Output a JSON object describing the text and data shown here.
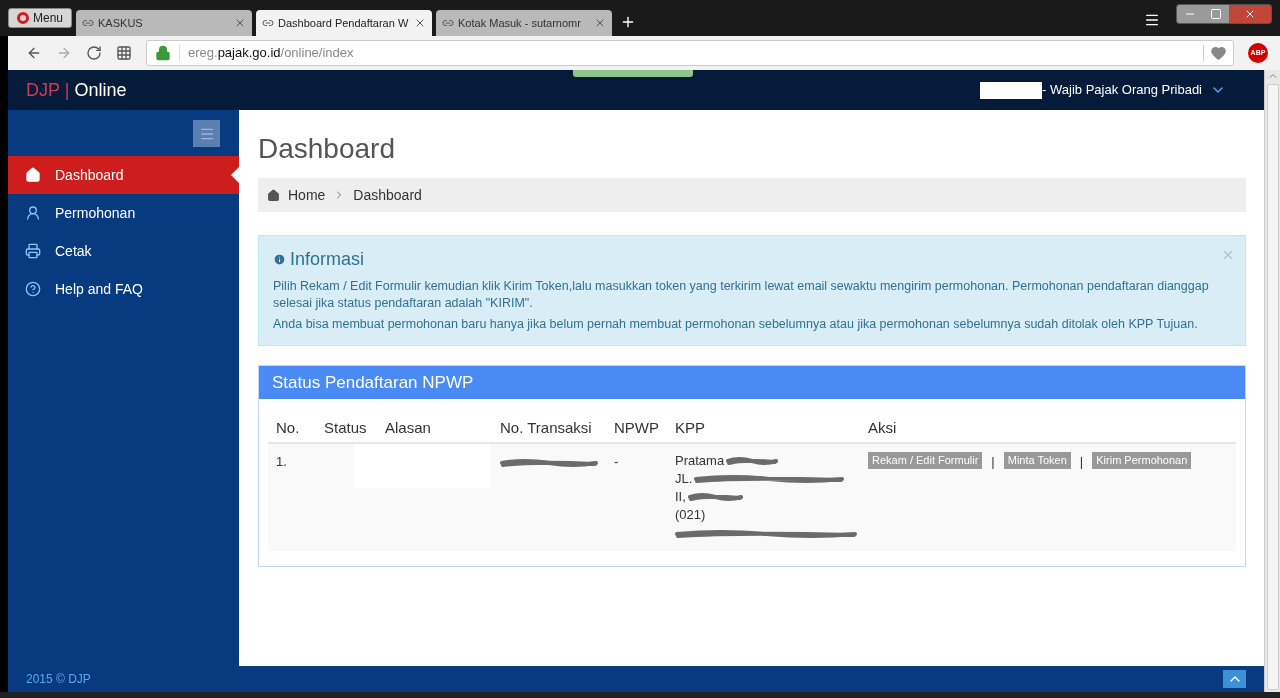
{
  "browser": {
    "menu": "Menu",
    "tabs": [
      {
        "title": "KASKUS",
        "selected": false
      },
      {
        "title": "Dashboard Pendaftaran W",
        "selected": true
      },
      {
        "title": "Kotak Masuk - sutarnomr",
        "selected": false
      }
    ],
    "address": {
      "prefix": "ereg.",
      "domain": "pajak.go.id",
      "path": "/online/index"
    },
    "extension_badge": "ABP"
  },
  "header": {
    "brand_left": "DJP",
    "brand_sep": "|",
    "brand_right": "Online",
    "user": "- Wajib Pajak Orang Pribadi"
  },
  "sidebar": {
    "items": [
      {
        "label": "Dashboard",
        "kind": "home",
        "selected": true
      },
      {
        "label": "Permohonan",
        "kind": "user",
        "selected": false
      },
      {
        "label": "Cetak",
        "kind": "print",
        "selected": false
      },
      {
        "label": "Help and FAQ",
        "kind": "help",
        "selected": false
      }
    ]
  },
  "page_title": "Dashboard",
  "breadcrumb": [
    "Home",
    "Dashboard"
  ],
  "alert": {
    "title": "Informasi",
    "paragraphs": [
      "Pilih Rekam / Edit Formulir kemudian klik Kirim Token,lalu masukkan token yang terkirim lewat email sewaktu mengirim permohonan. Permohonan pendaftaran dianggap selesai jika status pendaftaran adalah \"KIRIM\".",
      "Anda bisa membuat permohonan baru hanya jika belum pernah membuat permohonan sebelumnya atau jika permohonan sebelumnya sudah ditolak oleh KPP Tujuan."
    ]
  },
  "panel": {
    "title": "Status Pendaftaran NPWP",
    "columns": [
      "No.",
      "Status",
      "Alasan",
      "No. Transaksi",
      "NPWP",
      "KPP",
      "Aksi"
    ],
    "rows": [
      {
        "no": "1.",
        "npwp": "-",
        "kpp_lines": [
          "Pratama",
          "JL.",
          "II,",
          "(021)"
        ],
        "actions": [
          "Rekam / Edit Formulir",
          "Minta Token",
          "Kirim Permohonan"
        ],
        "action_sep": "|"
      }
    ]
  },
  "footer": "2015 © DJP"
}
